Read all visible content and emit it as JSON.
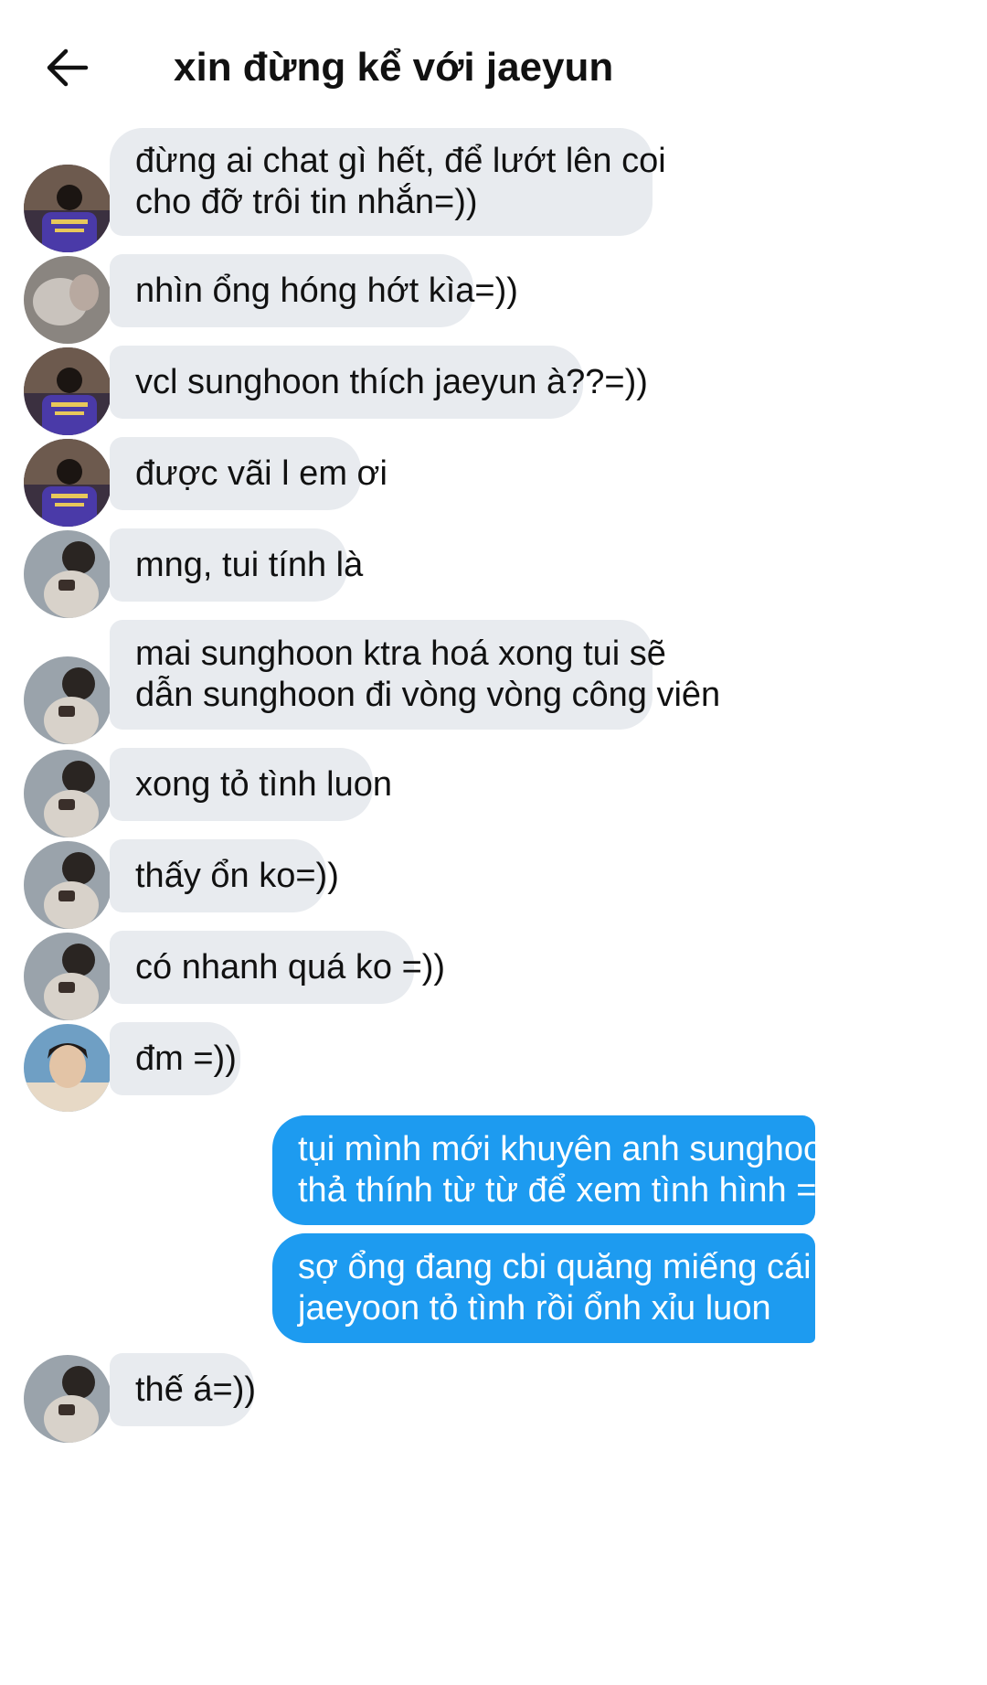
{
  "header": {
    "title": "xin đừng kể với jaeyun"
  },
  "messages": [
    {
      "lines": [
        "đừng ai chat gì hết, để lướt lên coi",
        "cho đỡ trôi tin nhắn=))"
      ]
    },
    {
      "lines": [
        "nhìn ổng hóng hớt kìa=))"
      ]
    },
    {
      "lines": [
        "vcl sunghoon thích jaeyun à??=))"
      ]
    },
    {
      "lines": [
        "được vãi l em ơi"
      ]
    },
    {
      "lines": [
        "mng, tui tính là"
      ]
    },
    {
      "lines": [
        "mai sunghoon ktra hoá xong tui sẽ",
        "dẫn sunghoon đi vòng vòng công viên"
      ]
    },
    {
      "lines": [
        "xong tỏ tình luon"
      ]
    },
    {
      "lines": [
        "thấy ổn ko=))"
      ]
    },
    {
      "lines": [
        "có nhanh quá ko =))"
      ]
    },
    {
      "lines": [
        "đm =))"
      ]
    },
    {
      "lines": [
        "tụi mình mới khuyên anh sunghoon",
        "thả thính từ từ để xem tình hình =))"
      ]
    },
    {
      "lines": [
        "sợ ổng đang cbi quăng miếng cái anh",
        "jaeyoon tỏ tình rồi ổnh xỉu luon"
      ]
    },
    {
      "lines": [
        "thế á=))"
      ]
    }
  ],
  "colors": {
    "incoming_bubble": "#e8ebef",
    "outgoing_bubble": "#1d9bf0",
    "text": "#111111"
  },
  "icons": {
    "back": "arrow-left-icon"
  }
}
